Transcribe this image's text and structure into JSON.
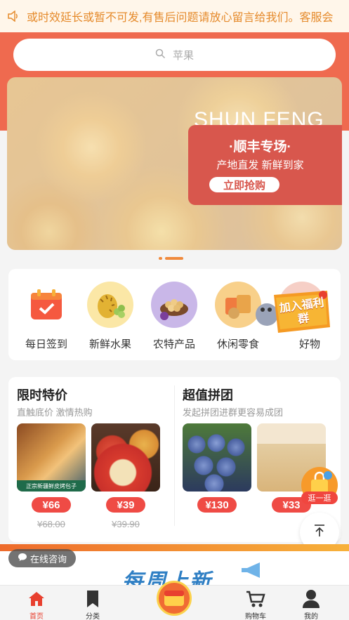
{
  "notice": {
    "text": "或时效延长或暂不可发,有售后问题请放心留言给我们。客服会"
  },
  "search": {
    "placeholder": "苹果"
  },
  "banner": {
    "english_title": "SHUN FENG",
    "promo_title": "·顺丰专场·",
    "promo_subtitle": "产地直发 新鲜到家",
    "promo_button": "立即抢购"
  },
  "categories": [
    {
      "label": "每日签到",
      "icon": "calendar-check-icon"
    },
    {
      "label": "新鲜水果",
      "icon": "durian-icon"
    },
    {
      "label": "农特产品",
      "icon": "nuts-icon"
    },
    {
      "label": "休闲零食",
      "icon": "snack-icon"
    },
    {
      "label": "好物",
      "icon": "goods-icon"
    }
  ],
  "welfare_badge": {
    "text": "加入福利群"
  },
  "deals": {
    "flash": {
      "title": "限时特价",
      "subtitle": "直触底价 激情热购",
      "products": [
        {
          "price": "¥66",
          "old_price": "¥68.00",
          "image_caption": "正宗新疆鲜皮烤包子"
        },
        {
          "price": "¥39",
          "old_price": "¥39.90"
        }
      ]
    },
    "group": {
      "title": "超值拼团",
      "subtitle": "发起拼团进群更容易成团",
      "products": [
        {
          "price": "¥130"
        },
        {
          "price": "¥33"
        }
      ]
    }
  },
  "float_shop": {
    "label": "逛一逛"
  },
  "weekly": {
    "text": "每周上新"
  },
  "consult": {
    "label": "在线咨询"
  },
  "tabbar": [
    {
      "label": "首页",
      "icon": "home-icon",
      "active": true
    },
    {
      "label": "分类",
      "icon": "bookmark-icon",
      "active": false
    },
    {
      "label": "购物车",
      "icon": "cart-icon",
      "active": false
    },
    {
      "label": "我的",
      "icon": "user-icon",
      "active": false
    }
  ],
  "colors": {
    "accent": "#ef6a4f",
    "price": "#ef4b45",
    "notice": "#e58a2b"
  }
}
